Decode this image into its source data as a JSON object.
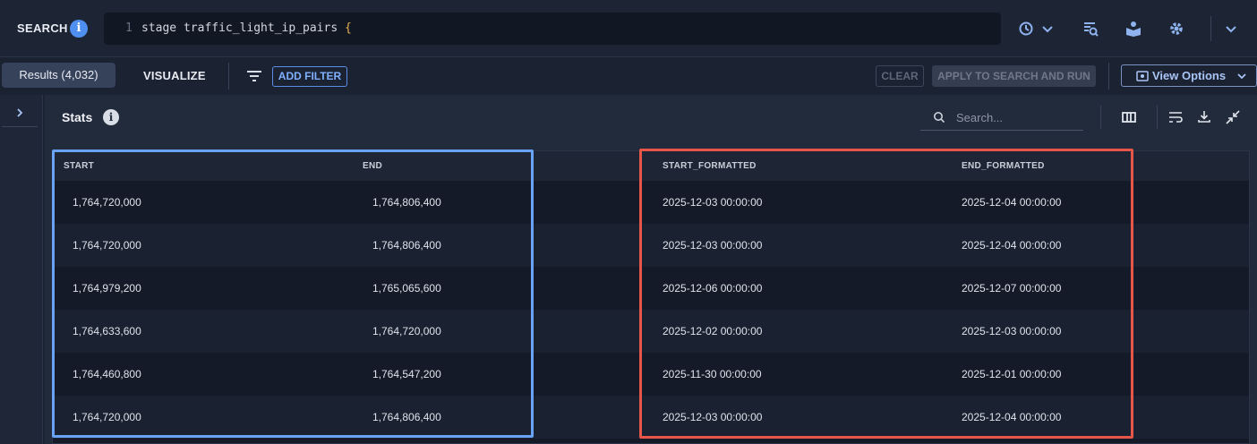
{
  "search": {
    "label": "SEARCH",
    "info_icon": "i",
    "line_number": "1",
    "query_text": "stage traffic_light_ip_pairs ",
    "query_brace": "{"
  },
  "toolbar": {
    "results_tab": "Results (4,032)",
    "visualize_tab": "VISUALIZE",
    "add_filter": "ADD FILTER",
    "clear": "CLEAR",
    "apply": "APPLY TO SEARCH AND RUN",
    "view_options": "View Options"
  },
  "panel": {
    "title": "Stats",
    "info_icon": "i",
    "search_placeholder": "Search..."
  },
  "table": {
    "columns": [
      "START",
      "END",
      "START_FORMATTED",
      "END_FORMATTED"
    ],
    "rows": [
      [
        "1,764,720,000",
        "1,764,806,400",
        "2025-12-03 00:00:00",
        "2025-12-04 00:00:00"
      ],
      [
        "1,764,720,000",
        "1,764,806,400",
        "2025-12-03 00:00:00",
        "2025-12-04 00:00:00"
      ],
      [
        "1,764,979,200",
        "1,765,065,600",
        "2025-12-06 00:00:00",
        "2025-12-07 00:00:00"
      ],
      [
        "1,764,633,600",
        "1,764,720,000",
        "2025-12-02 00:00:00",
        "2025-12-03 00:00:00"
      ],
      [
        "1,764,460,800",
        "1,764,547,200",
        "2025-11-30 00:00:00",
        "2025-12-01 00:00:00"
      ],
      [
        "1,764,720,000",
        "1,764,806,400",
        "2025-12-03 00:00:00",
        "2025-12-04 00:00:00"
      ]
    ]
  },
  "colors": {
    "accent_blue": "#4f8ff0",
    "highlight_blue": "#6aa3f5",
    "highlight_red": "#e8564a"
  }
}
